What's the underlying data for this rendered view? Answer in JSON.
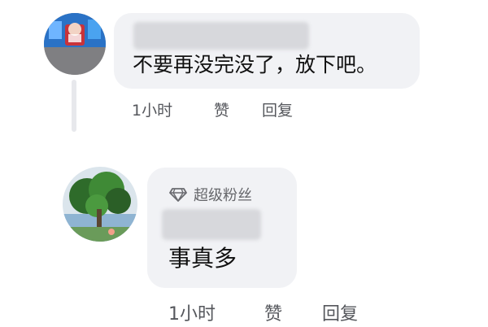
{
  "comments": [
    {
      "text": "不要再没完没了，放下吧。",
      "time": "1小时",
      "like_label": "赞",
      "reply_label": "回复"
    },
    {
      "badge": "超级粉丝",
      "badge_icon": "diamond-icon",
      "text": "事真多",
      "time": "1小时",
      "like_label": "赞",
      "reply_label": "回复"
    }
  ],
  "colors": {
    "bubble_bg": "#f1f2f5",
    "meta_text": "#55575c",
    "badge_text": "#66676b"
  }
}
